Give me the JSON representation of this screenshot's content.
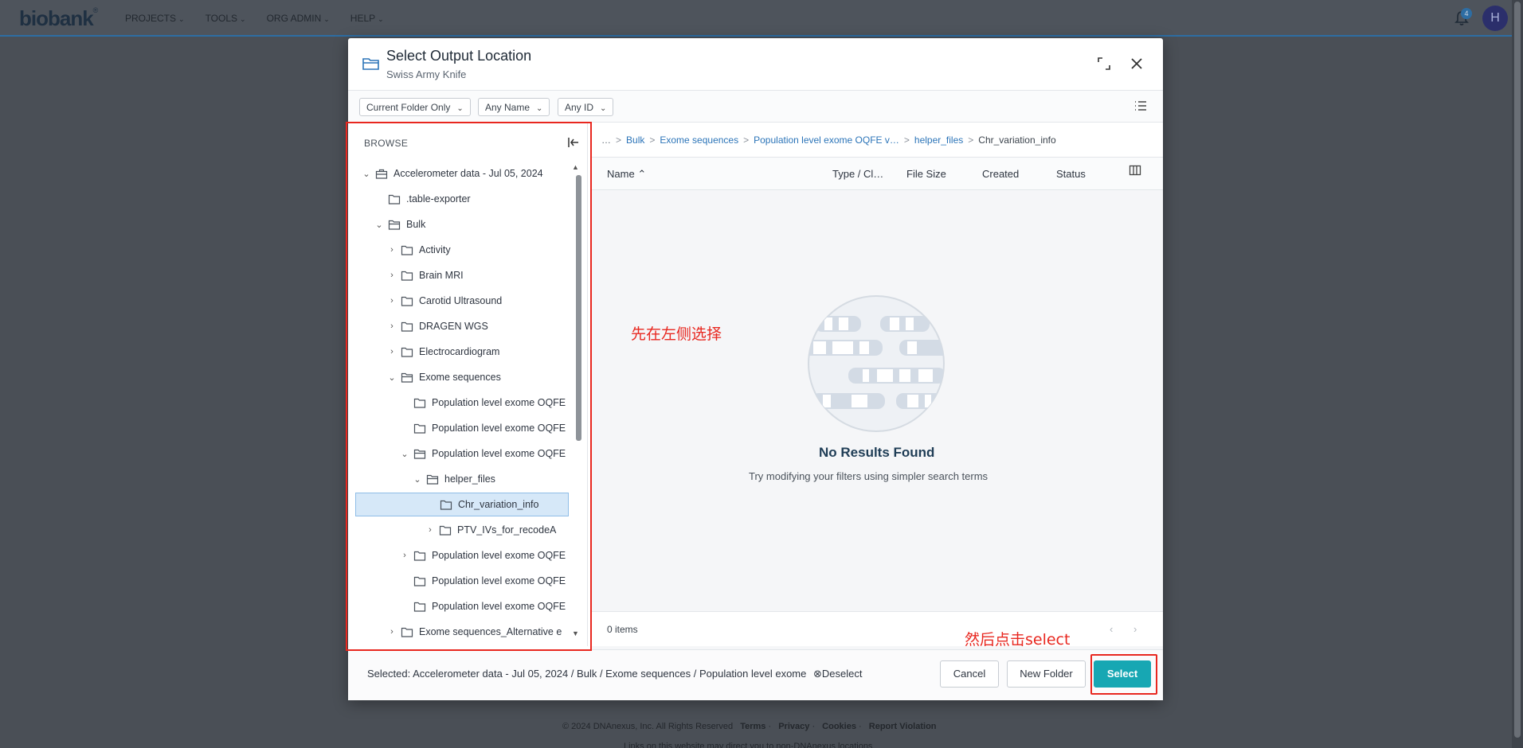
{
  "nav": {
    "brand": "biobank",
    "brand_mark": "®",
    "items": [
      {
        "label": "PROJECTS"
      },
      {
        "label": "TOOLS"
      },
      {
        "label": "ORG ADMIN"
      },
      {
        "label": "HELP"
      }
    ],
    "notification_count": "4",
    "avatar_initial": "H"
  },
  "modal": {
    "title": "Select Output Location",
    "subtitle": "Swiss Army Knife",
    "filters": [
      {
        "label": "Current Folder Only"
      },
      {
        "label": "Any Name"
      },
      {
        "label": "Any ID"
      }
    ],
    "browse_label": "BROWSE",
    "tree": [
      {
        "label": "Accelerometer data - Jul 05, 2024",
        "toggle": "⌄",
        "kind": "project",
        "depth": 0
      },
      {
        "label": ".table-exporter",
        "toggle": "",
        "kind": "folder",
        "depth": 1
      },
      {
        "label": "Bulk",
        "toggle": "⌄",
        "kind": "folder-open",
        "depth": 1
      },
      {
        "label": "Activity",
        "toggle": "›",
        "kind": "folder",
        "depth": 2
      },
      {
        "label": "Brain MRI",
        "toggle": "›",
        "kind": "folder",
        "depth": 2
      },
      {
        "label": "Carotid Ultrasound",
        "toggle": "›",
        "kind": "folder",
        "depth": 2
      },
      {
        "label": "DRAGEN WGS",
        "toggle": "›",
        "kind": "folder",
        "depth": 2
      },
      {
        "label": "Electrocardiogram",
        "toggle": "›",
        "kind": "folder",
        "depth": 2
      },
      {
        "label": "Exome sequences",
        "toggle": "⌄",
        "kind": "folder-open",
        "depth": 2
      },
      {
        "label": "Population level exome OQFE",
        "toggle": "",
        "kind": "folder",
        "depth": 3
      },
      {
        "label": "Population level exome OQFE",
        "toggle": "",
        "kind": "folder",
        "depth": 3
      },
      {
        "label": "Population level exome OQFE",
        "toggle": "⌄",
        "kind": "folder-open",
        "depth": 3
      },
      {
        "label": "helper_files",
        "toggle": "⌄",
        "kind": "folder-open",
        "depth": 4
      },
      {
        "label": "Chr_variation_info",
        "toggle": "",
        "kind": "folder",
        "depth": 5,
        "selected": true
      },
      {
        "label": "PTV_IVs_for_recodeA",
        "toggle": "›",
        "kind": "folder",
        "depth": 5
      },
      {
        "label": "Population level exome OQFE",
        "toggle": "›",
        "kind": "folder",
        "depth": 3
      },
      {
        "label": "Population level exome OQFE",
        "toggle": "",
        "kind": "folder",
        "depth": 3
      },
      {
        "label": "Population level exome OQFE",
        "toggle": "",
        "kind": "folder",
        "depth": 3
      },
      {
        "label": "Exome sequences_Alternative e",
        "toggle": "›",
        "kind": "folder",
        "depth": 2
      }
    ],
    "breadcrumb": [
      {
        "label": "…",
        "link": true
      },
      {
        "label": "Bulk",
        "link": true
      },
      {
        "label": "Exome sequences",
        "link": true
      },
      {
        "label": "Population level exome OQFE v…",
        "link": true
      },
      {
        "label": "helper_files",
        "link": true
      },
      {
        "label": "Chr_variation_info",
        "link": false
      }
    ],
    "table_columns": {
      "name": "Name",
      "name_sort": "⌃",
      "type": "Type / Cl…",
      "size": "File Size",
      "created": "Created",
      "status": "Status"
    },
    "empty_title": "No Results Found",
    "empty_message": "Try modifying your filters using simpler search terms",
    "items_count": "0 items",
    "selected_path": "Selected: Accelerometer data - Jul 05, 2024 / Bulk / Exome sequences / Population level exome OQFE",
    "deselect_label": "Deselect",
    "buttons": {
      "cancel": "Cancel",
      "new_folder": "New Folder",
      "select": "Select"
    }
  },
  "annotations": {
    "left_hint": "先在左侧选择",
    "right_hint": "然后点击select"
  },
  "footer": {
    "copyright": "© 2024 DNAnexus, Inc. All Rights Reserved",
    "links": [
      "Terms",
      "Privacy",
      "Cookies",
      "Report Violation"
    ],
    "separator": "·",
    "note": "Links on this website may direct you to non-DNAnexus locations"
  },
  "colors": {
    "accent": "#17a7b3",
    "link": "#2b74b8",
    "annotation": "#e8271f",
    "selection": "#d6e8f8"
  }
}
